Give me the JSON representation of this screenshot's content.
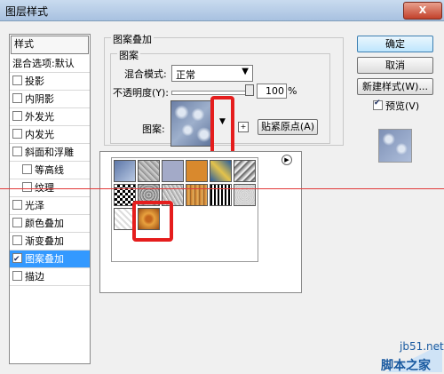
{
  "window": {
    "title": "图层样式",
    "close": "X"
  },
  "styles_list": {
    "header": "样式",
    "blend_item": "混合选项:默认",
    "items": [
      {
        "label": "投影",
        "checked": false
      },
      {
        "label": "内阴影",
        "checked": false
      },
      {
        "label": "外发光",
        "checked": false
      },
      {
        "label": "内发光",
        "checked": false
      },
      {
        "label": "斜面和浮雕",
        "checked": false
      },
      {
        "label": "等高线",
        "checked": false
      },
      {
        "label": "纹理",
        "checked": false
      },
      {
        "label": "光泽",
        "checked": false
      },
      {
        "label": "颜色叠加",
        "checked": false
      },
      {
        "label": "渐变叠加",
        "checked": false
      },
      {
        "label": "图案叠加",
        "checked": true
      },
      {
        "label": "描边",
        "checked": false
      }
    ]
  },
  "panel": {
    "group_title": "图案叠加",
    "subgroup_title": "图案",
    "blend_label": "混合模式:",
    "blend_value": "正常",
    "opacity_label": "不透明度(Y):",
    "opacity_value": "100",
    "opacity_unit": "%",
    "pattern_label": "图案:",
    "snap_button": "贴紧原点(A)"
  },
  "buttons": {
    "ok": "确定",
    "cancel": "取消",
    "new_style": "新建样式(W)...",
    "preview": "预览(V)"
  },
  "watermark": {
    "line1": "jb51.net",
    "line2": "脚本之家"
  }
}
